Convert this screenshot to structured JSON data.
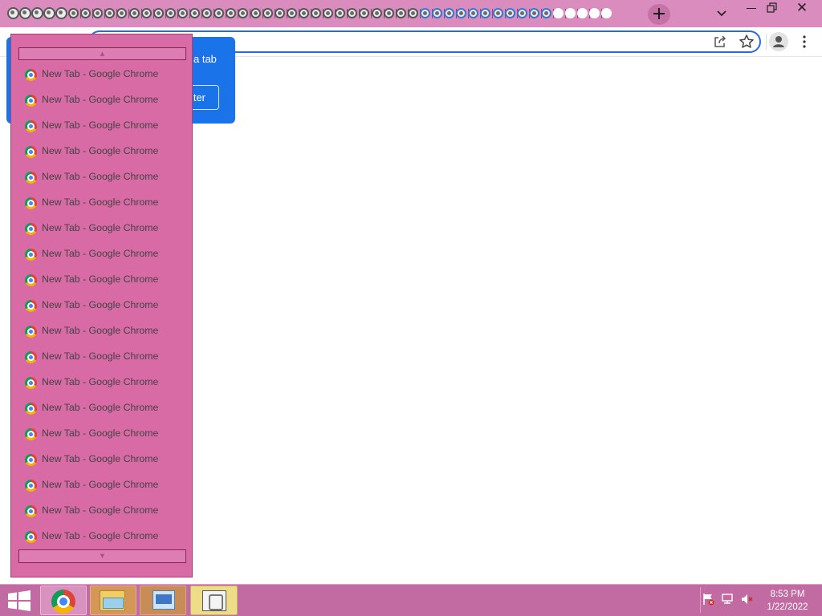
{
  "browser": {
    "tab_strip": {
      "tab_favicon_count": 50,
      "new_tab_symbol": "+",
      "tab_search_icon": "chevron-down-icon",
      "window_controls": {
        "minimize_icon": "minimize-icon",
        "restore_icon": "restore-icon",
        "close_symbol": "✕"
      }
    },
    "toolbar": {
      "omnibox_value": "",
      "icons": [
        "share-icon",
        "star-icon",
        "profile-icon",
        "menu-icon"
      ]
    },
    "promo_bubble": {
      "text_fragment": "a tab",
      "button_fragment": "ter"
    },
    "tab_list_dropdown": {
      "scroll_up_glyph": "▲",
      "scroll_down_glyph": "▼",
      "items": [
        {
          "label": "New Tab - Google Chrome"
        },
        {
          "label": "New Tab - Google Chrome"
        },
        {
          "label": "New Tab - Google Chrome"
        },
        {
          "label": "New Tab - Google Chrome"
        },
        {
          "label": "New Tab - Google Chrome"
        },
        {
          "label": "New Tab - Google Chrome"
        },
        {
          "label": "New Tab - Google Chrome"
        },
        {
          "label": "New Tab - Google Chrome"
        },
        {
          "label": "New Tab - Google Chrome"
        },
        {
          "label": "New Tab - Google Chrome"
        },
        {
          "label": "New Tab - Google Chrome"
        },
        {
          "label": "New Tab - Google Chrome"
        },
        {
          "label": "New Tab - Google Chrome"
        },
        {
          "label": "New Tab - Google Chrome"
        },
        {
          "label": "New Tab - Google Chrome"
        },
        {
          "label": "New Tab - Google Chrome"
        },
        {
          "label": "New Tab - Google Chrome"
        },
        {
          "label": "New Tab - Google Chrome"
        },
        {
          "label": "New Tab - Google Chrome"
        }
      ]
    }
  },
  "taskbar": {
    "start_icon": "windows-logo-icon",
    "apps": [
      {
        "name": "chrome-icon"
      },
      {
        "name": "file-explorer-icon"
      },
      {
        "name": "remote-desktop-icon"
      },
      {
        "name": "app-icon"
      }
    ],
    "tray_icons": [
      "action-center-flag-icon",
      "network-icon",
      "volume-muted-icon"
    ],
    "clock": {
      "time": "8:53 PM",
      "date": "1/22/2022"
    }
  },
  "colors": {
    "tab_strip": "#d98cbd",
    "dropdown_bg": "#d86aa6",
    "bubble": "#1a73e8",
    "taskbar": "#c16ba2"
  }
}
